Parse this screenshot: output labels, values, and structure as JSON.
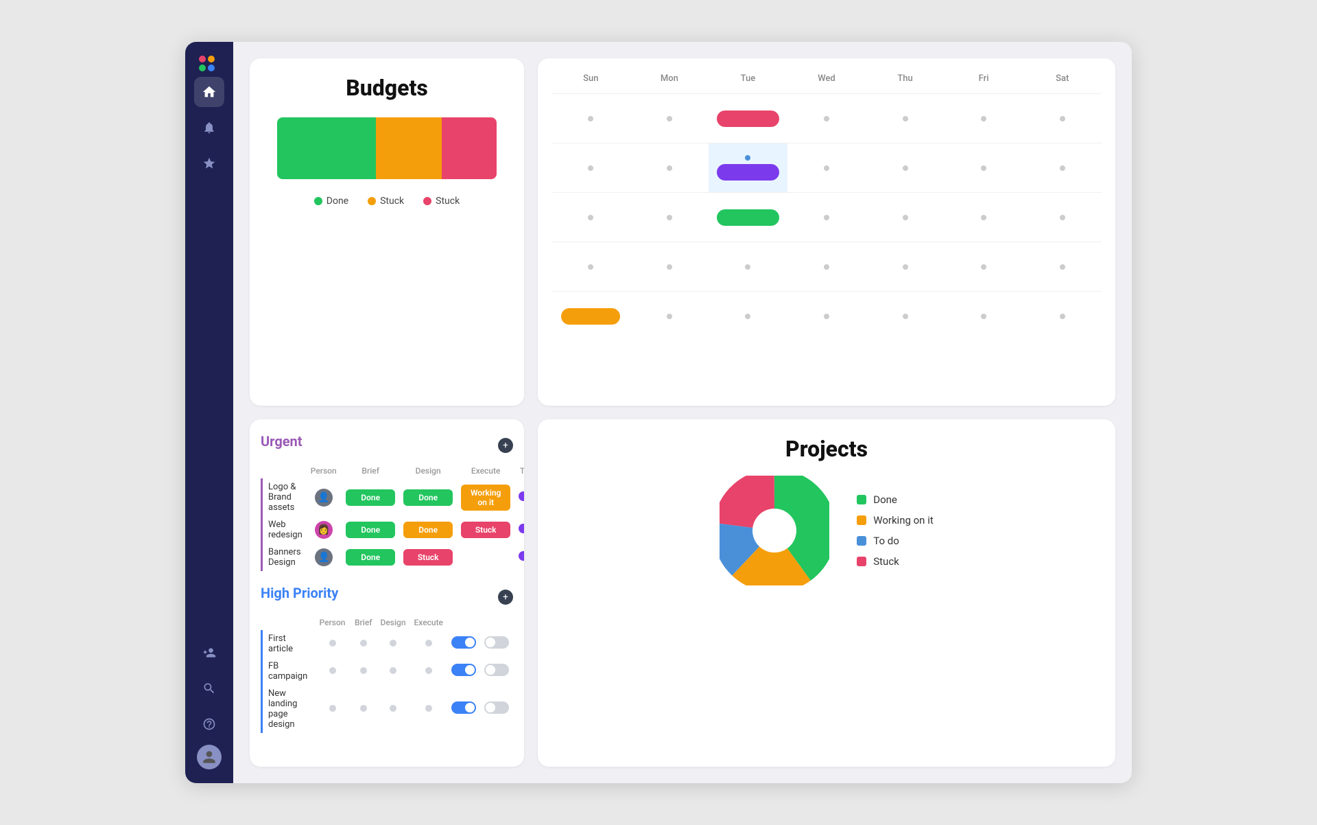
{
  "sidebar": {
    "logo": "⬡",
    "nav_items": [
      {
        "id": "home",
        "icon": "⌂",
        "active": true
      },
      {
        "id": "notifications",
        "icon": "🔔"
      },
      {
        "id": "favorites",
        "icon": "☆"
      },
      {
        "id": "users",
        "icon": "👤"
      },
      {
        "id": "search",
        "icon": "🔍"
      },
      {
        "id": "help",
        "icon": "?"
      }
    ]
  },
  "budgets": {
    "title": "Budgets",
    "bar_segments": [
      {
        "color": "#22c55e",
        "flex": 45
      },
      {
        "color": "#f59e0b",
        "flex": 30
      },
      {
        "color": "#e8436a",
        "flex": 25
      }
    ],
    "legend": [
      {
        "label": "Done",
        "color": "#22c55e"
      },
      {
        "label": "Stuck",
        "color": "#f59e0b"
      },
      {
        "label": "Stuck",
        "color": "#e8436a"
      }
    ]
  },
  "calendar": {
    "days": [
      "Sun",
      "Mon",
      "Tue",
      "Wed",
      "Thu",
      "Fri",
      "Sat"
    ],
    "rows": [
      {
        "cells": [
          "dot",
          "dot",
          "pink",
          "dot",
          "dot",
          "dot",
          "dot"
        ]
      },
      {
        "cells": [
          "dot",
          "dot",
          "purple-highlight",
          "dot",
          "dot",
          "dot",
          "dot"
        ]
      },
      {
        "cells": [
          "dot",
          "dot",
          "green",
          "dot",
          "dot",
          "dot",
          "dot"
        ]
      },
      {
        "cells": [
          "dot",
          "dot",
          "dot",
          "dot",
          "dot",
          "dot",
          "dot"
        ]
      },
      {
        "cells": [
          "orange",
          "dot",
          "dot",
          "dot",
          "dot",
          "dot",
          "dot"
        ]
      }
    ]
  },
  "tasks": {
    "urgent_title": "Urgent",
    "urgent_columns": [
      "Person",
      "Brief",
      "Design",
      "Execute",
      "Timeline"
    ],
    "urgent_rows": [
      {
        "name": "Logo & Brand assets",
        "person": "👤",
        "brief": "Done",
        "design": "Done",
        "execute": "Working on it",
        "timeline": true,
        "toggle": true
      },
      {
        "name": "Web redesign",
        "person": "👩",
        "brief": "Done",
        "design": "Done",
        "execute": "Stuck",
        "timeline": true,
        "toggle": true
      },
      {
        "name": "Banners Design",
        "person": "👤",
        "brief": "Done",
        "design": "Stuck",
        "execute": "",
        "timeline": true,
        "toggle": false
      }
    ],
    "high_priority_title": "High Priority",
    "high_columns": [
      "Person",
      "Brief",
      "Design",
      "Execute"
    ],
    "high_rows": [
      {
        "name": "First article",
        "toggle": true
      },
      {
        "name": "FB campaign",
        "toggle": true
      },
      {
        "name": "New landing page design",
        "toggle": true
      }
    ]
  },
  "projects": {
    "title": "Projects",
    "legend": [
      {
        "label": "Done",
        "color": "#22c55e"
      },
      {
        "label": "Working on it",
        "color": "#f59e0b"
      },
      {
        "label": "To do",
        "color": "#4a90d9"
      },
      {
        "label": "Stuck",
        "color": "#e8436a"
      }
    ],
    "pie_slices": [
      {
        "label": "Done",
        "color": "#22c55e",
        "percent": 40
      },
      {
        "label": "Working on it",
        "color": "#f59e0b",
        "percent": 22
      },
      {
        "label": "To do",
        "color": "#4a90d9",
        "percent": 15
      },
      {
        "label": "Stuck",
        "color": "#e8436a",
        "percent": 23
      }
    ]
  }
}
